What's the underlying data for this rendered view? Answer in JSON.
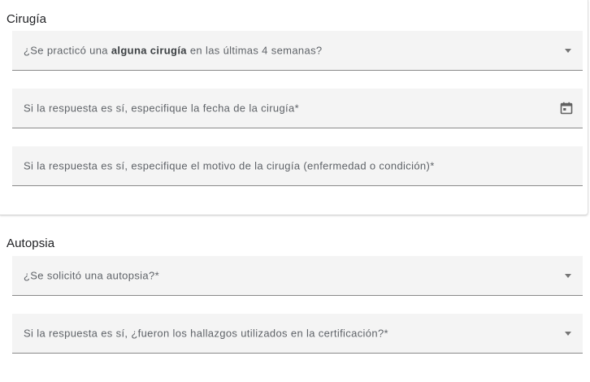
{
  "surgery": {
    "title": "Cirugía",
    "had_surgery": {
      "label_prefix": "¿Se practicó una ",
      "label_bold": "alguna cirugía",
      "label_suffix": " en las últimas 4 semanas?"
    },
    "surgery_date": {
      "label": "Si la respuesta es sí, especifique la fecha de la cirugía*",
      "icon": "calendar-icon"
    },
    "surgery_reason": {
      "label": "Si la respuesta es sí, especifique el motivo de la cirugía (enfermedad o condición)*"
    }
  },
  "autopsy": {
    "title": "Autopsia",
    "autopsy_requested": {
      "label": "¿Se solicitó una autopsia?*"
    },
    "findings_used": {
      "label": "Si la respuesta es sí, ¿fueron los hallazgos utilizados en la certificación?*"
    }
  }
}
